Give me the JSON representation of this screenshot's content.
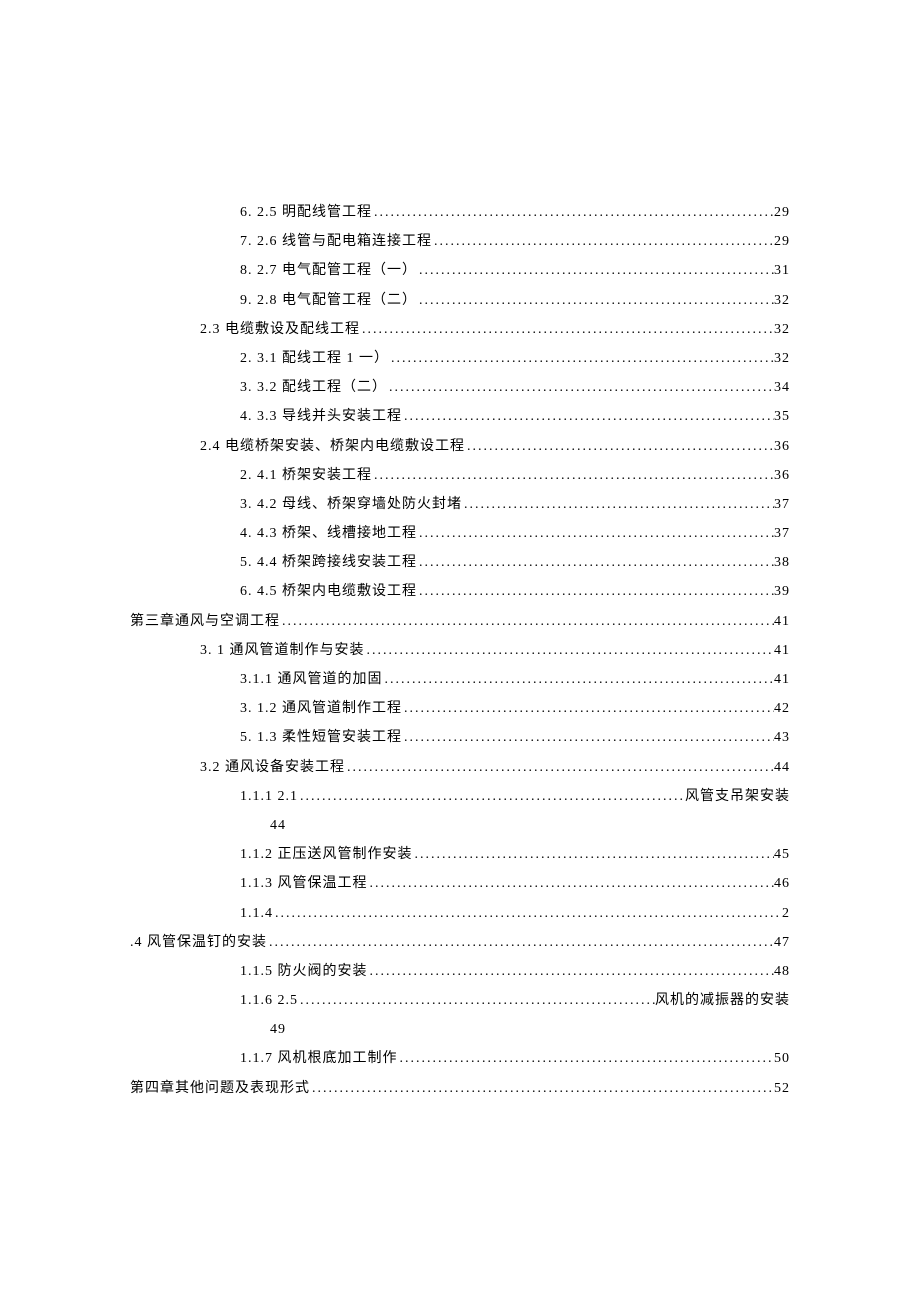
{
  "toc": [
    {
      "indent": "indent-2",
      "prefix": "6.  2.5   明配线管工程 ",
      "page": " 29"
    },
    {
      "indent": "indent-2",
      "prefix": "7.  2.6   线管与配电箱连接工程 ",
      "page": " 29"
    },
    {
      "indent": "indent-2",
      "prefix": "8.  2.7   电气配管工程（一）",
      "page": " 31"
    },
    {
      "indent": "indent-2",
      "prefix": "9.  2.8   电气配管工程（二）",
      "page": " 32"
    },
    {
      "indent": "indent-1",
      "prefix": "2.3     电缆敷设及配线工程 ",
      "page": " 32"
    },
    {
      "indent": "indent-2",
      "prefix": "2.  3.1 配线工程 1 一）",
      "page": " 32"
    },
    {
      "indent": "indent-2",
      "prefix": "3.  3.2 配线工程（二）",
      "page": " 34"
    },
    {
      "indent": "indent-2",
      "prefix": "4.  3.3   导线并头安装工程 ",
      "page": " 35"
    },
    {
      "indent": "indent-1",
      "prefix": "2.4 电缆桥架安装、桥架内电缆敷设工程 ",
      "page": " 36"
    },
    {
      "indent": "indent-2",
      "prefix": "2.  4.1   桥架安装工程 ",
      "page": " 36"
    },
    {
      "indent": "indent-2",
      "prefix": "3.  4.2 母线、桥架穿墙处防火封堵 ",
      "page": " 37"
    },
    {
      "indent": "indent-2",
      "prefix": "4.  4.3   桥架、线槽接地工程 ",
      "page": " 37"
    },
    {
      "indent": "indent-2",
      "prefix": "5.  4.4   桥架跨接线安装工程 ",
      "page": " 38"
    },
    {
      "indent": "indent-2",
      "prefix": "6.  4.5   桥架内电缆敷设工程 ",
      "page": " 39"
    },
    {
      "indent": "indent-0",
      "prefix": "第三章通风与空调工程 ",
      "page": " 41"
    },
    {
      "indent": "indent-1",
      "prefix": "3.   1 通风管道制作与安装",
      "page": " 41"
    },
    {
      "indent": "indent-2",
      "prefix": "3.1.1 通风管道的加固",
      "page": " 41"
    },
    {
      "indent": "indent-2",
      "prefix": "3.  1.2 通风管道制作工程 ",
      "page": " 42"
    },
    {
      "indent": "indent-2",
      "prefix": "5.  1.3   柔性短管安装工程 ",
      "page": " 43"
    },
    {
      "indent": "indent-1",
      "prefix": "3.2 通风设备安装工程 ",
      "page": " 44"
    },
    {
      "indent": "indent-2",
      "prefix": "1.1.1     2.1",
      "page": "风管支吊架安装",
      "special": "right-text"
    },
    {
      "indent": "wrap",
      "text": "44"
    },
    {
      "indent": "indent-2",
      "prefix": "1.1.2     正压送风管制作安装 ",
      "page": " 45"
    },
    {
      "indent": "indent-2",
      "prefix": "1.1.3     风管保温工程 ",
      "page": " 46"
    },
    {
      "indent": "indent-2",
      "prefix": "1.1.4 ",
      "page": " 2"
    },
    {
      "indent": "indent-0",
      "prefix": ".4 风管保温钉的安装 ",
      "page": " 47"
    },
    {
      "indent": "indent-2",
      "prefix": "1.1.5     防火阀的安装 ",
      "page": " 48"
    },
    {
      "indent": "indent-2",
      "prefix": "1.1.6     2.5",
      "page": "风机的减振器的安装",
      "special": "right-text"
    },
    {
      "indent": "wrap",
      "text": "49"
    },
    {
      "indent": "indent-2",
      "prefix": "1.1.7     风机根底加工制作 ",
      "page": " 50"
    },
    {
      "indent": "indent-0",
      "prefix": "第四章其他问题及表现形式 ",
      "page": " 52"
    }
  ]
}
